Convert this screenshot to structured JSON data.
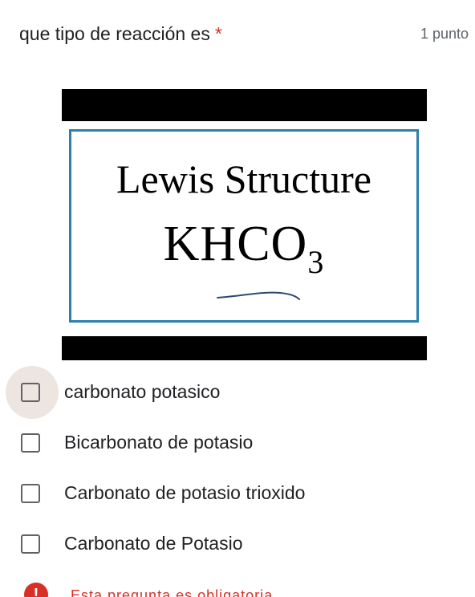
{
  "question": {
    "title": "que tipo de reacción es",
    "required_marker": "*",
    "points": "1 punto"
  },
  "image": {
    "heading": "Lewis Structure",
    "formula_main": "KHCO",
    "formula_subscript": "3"
  },
  "options": [
    {
      "label": "carbonato potasico",
      "checked": false
    },
    {
      "label": "Bicarbonato de potasio",
      "checked": false
    },
    {
      "label": "Carbonato de potasio trioxido",
      "checked": false
    },
    {
      "label": "Carbonato de Potasio",
      "checked": false
    }
  ],
  "validation": {
    "icon": "alert-icon",
    "message": "Esta pregunta es obligatoria"
  },
  "colors": {
    "required": "#d93025",
    "frame": "#2d7fae",
    "hover": "#ede5e0"
  }
}
